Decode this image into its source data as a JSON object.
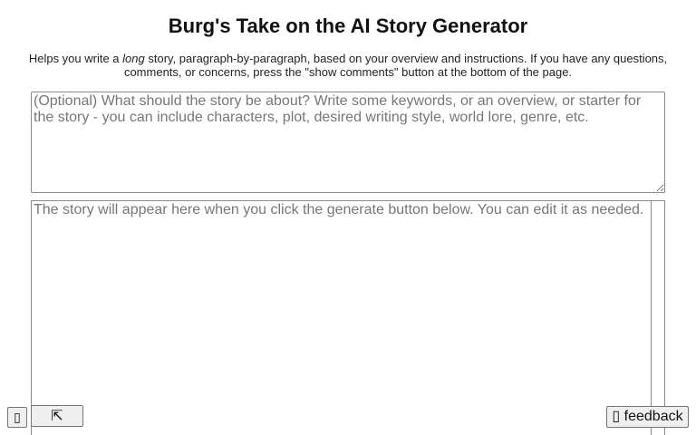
{
  "header": {
    "title": "Burg's Take on the AI Story Generator",
    "intro_before": "Helps you write a ",
    "intro_emphasis": "long",
    "intro_after": " story, paragraph-by-paragraph, based on your overview and instructions. If you have any questions, comments, or concerns, press the \"show comments\" button at the bottom of the page."
  },
  "overview_input": {
    "placeholder": "(Optional) What should the story be about? Write some keywords, or an overview, or starter for the story - you can include characters, plot, desired writing style, world lore, genre, etc.",
    "value": ""
  },
  "story_output": {
    "placeholder": "The story will appear here when you click the generate button below. You can edit it as needed.",
    "value": ""
  },
  "floating_buttons": {
    "left_icon_glyph": "▯",
    "minimize_icon_glyph": "⇱",
    "feedback_icon_glyph": "▯",
    "feedback_label": "feedback"
  }
}
